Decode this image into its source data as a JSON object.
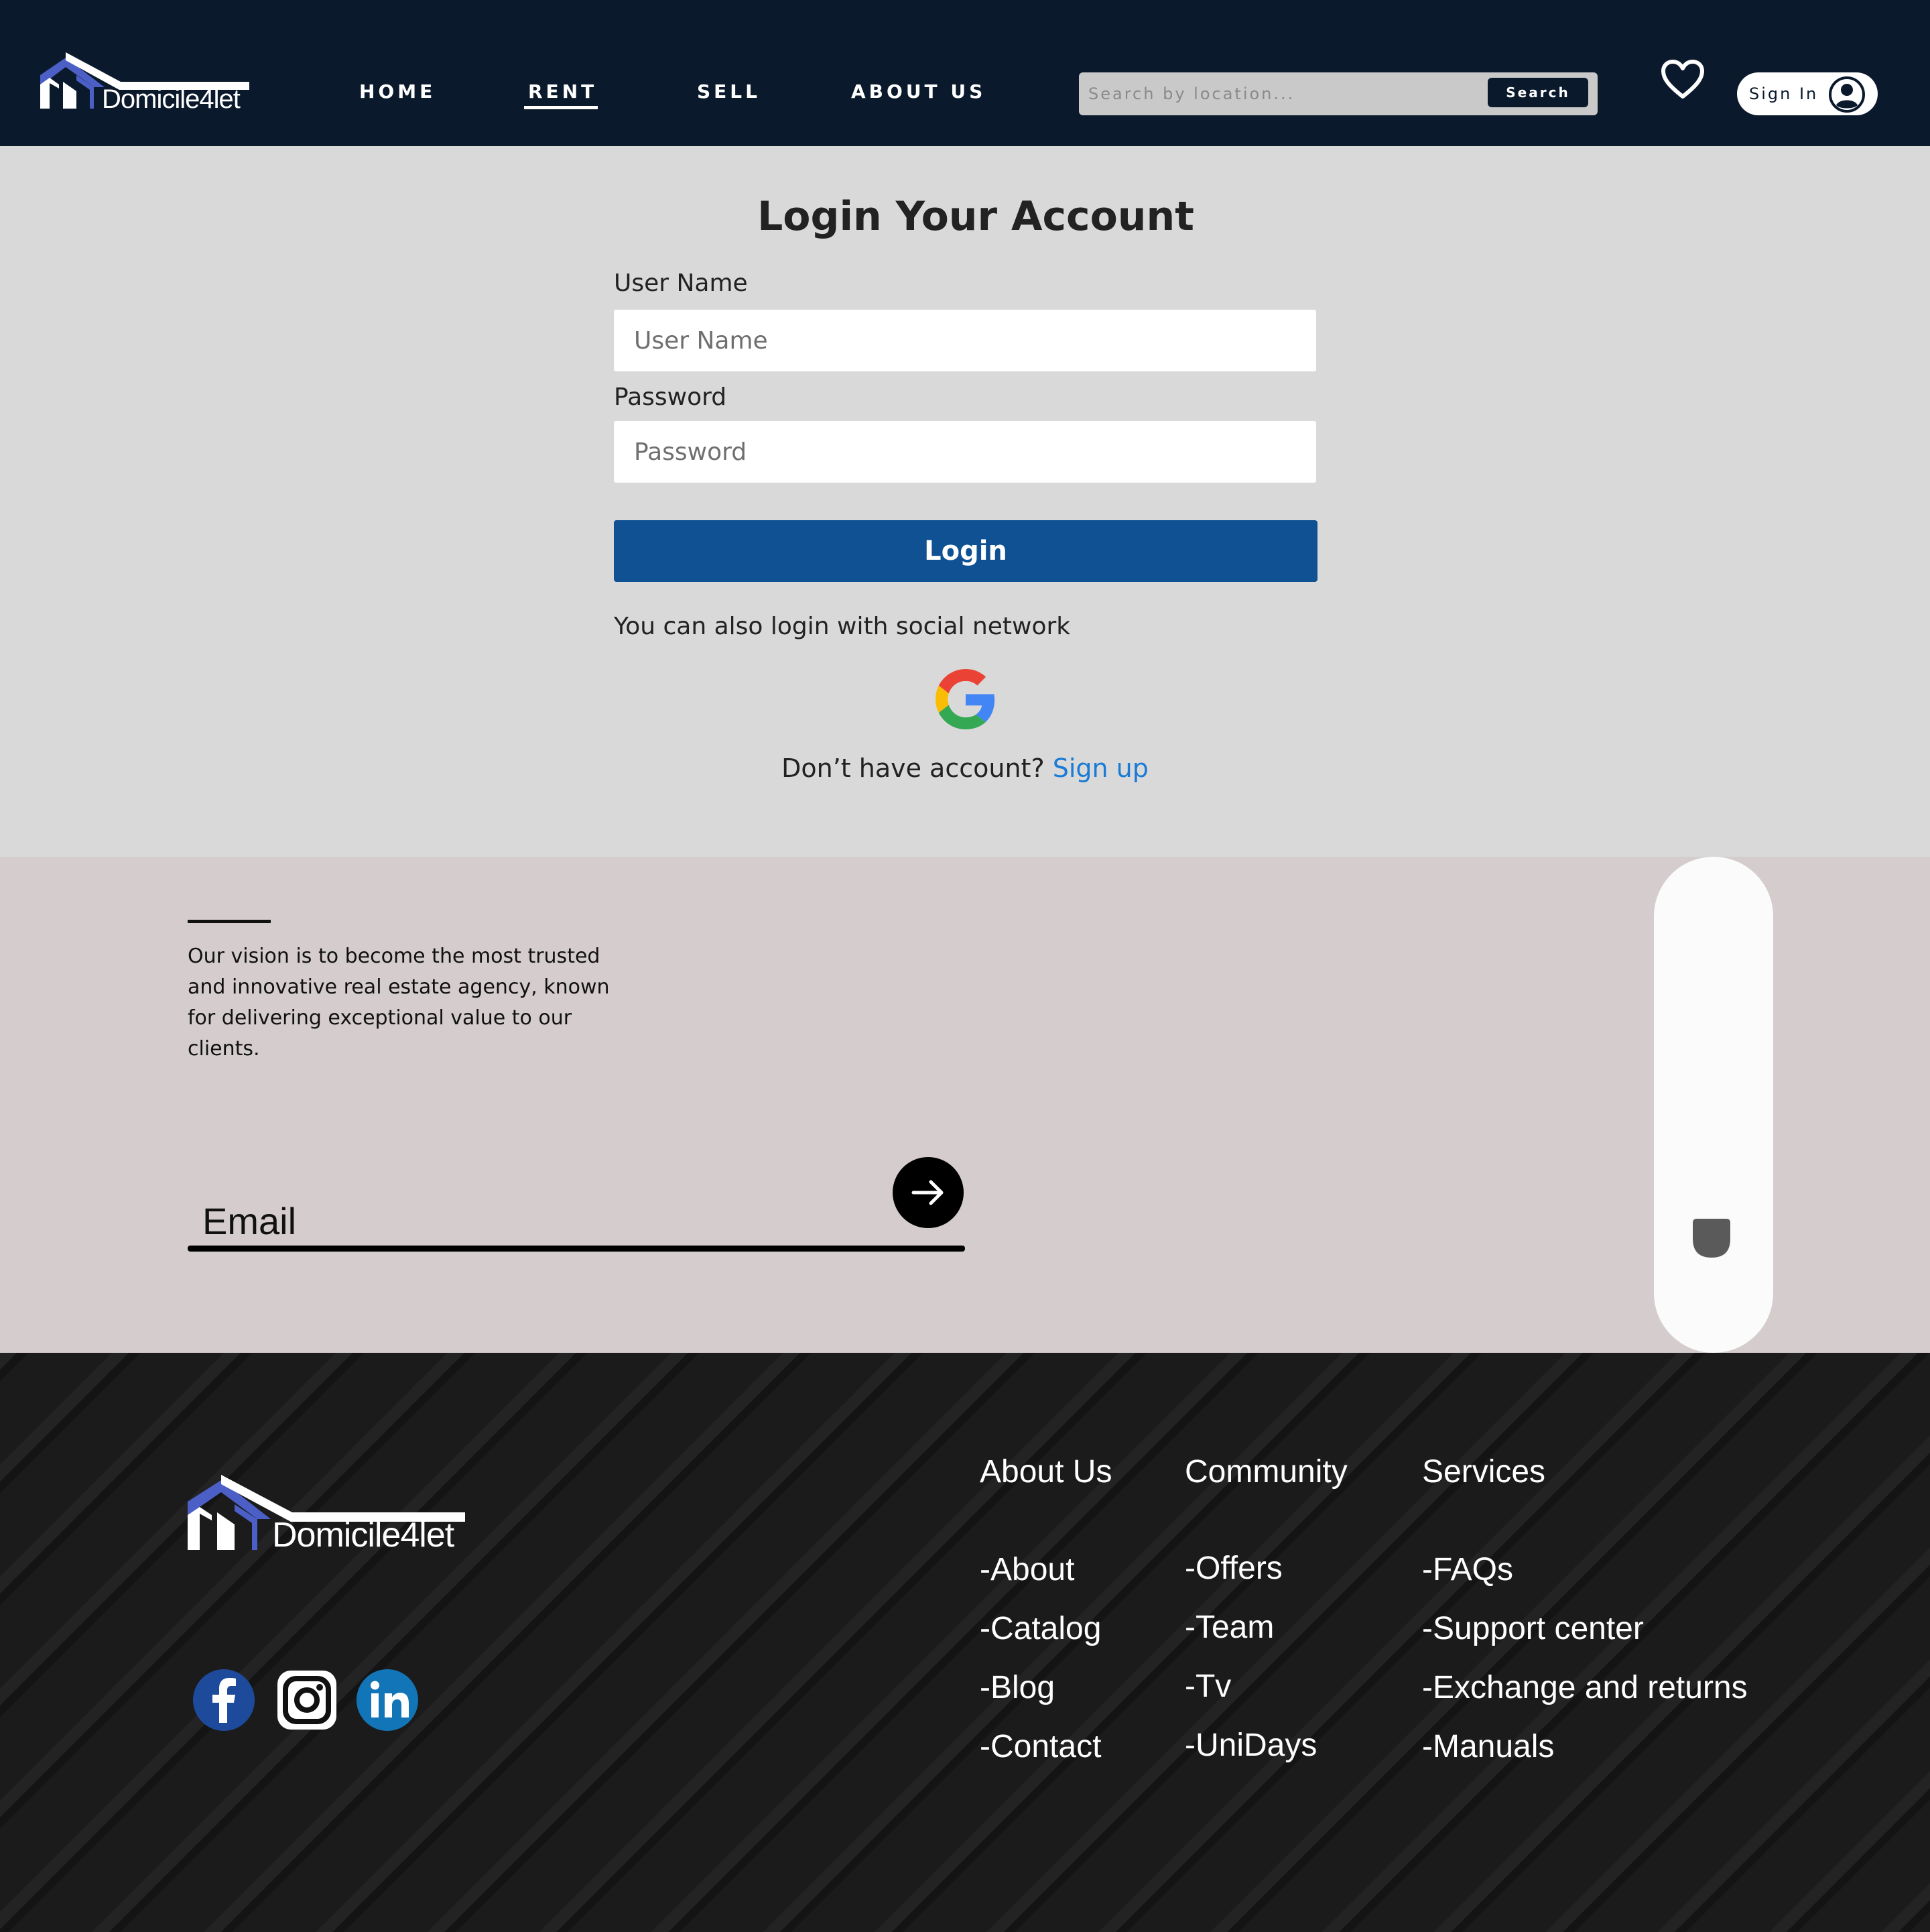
{
  "header": {
    "logo_text": "Domicile4let",
    "nav": [
      {
        "label": "HOME"
      },
      {
        "label": "RENT"
      },
      {
        "label": "SELL"
      },
      {
        "label": "ABOUT US"
      }
    ],
    "active_nav": "RENT",
    "search": {
      "placeholder": "Search by location...",
      "button_label": "Search"
    },
    "wishlist_icon": "heart-icon",
    "signin_label": "Sign In",
    "avatar_icon": "user-circle-icon"
  },
  "login": {
    "title": "Login Your Account",
    "username_label": "User Name",
    "username_placeholder": "User Name",
    "password_label": "Password",
    "password_placeholder": "Password",
    "login_button": "Login",
    "social_text": "You can also login with social network",
    "social_icon": "google-icon",
    "no_account_text": "Don’t have account?",
    "signup_link": "Sign up"
  },
  "newsletter": {
    "vision_text": "Our vision is to become the most trusted and innovative real estate agency, known for delivering exceptional value to our clients.",
    "email_placeholder": "Email",
    "submit_icon": "arrow-right-icon"
  },
  "footer": {
    "logo_text": "Domicile4let",
    "social": [
      "facebook-icon",
      "instagram-icon",
      "linkedin-icon"
    ],
    "columns": [
      {
        "title": "About Us",
        "links": [
          "-About",
          "-Catalog",
          "-Blog",
          "-Contact"
        ]
      },
      {
        "title": "Community",
        "links": [
          "-Offers",
          "-Team",
          "-Tv",
          "-UniDays"
        ]
      },
      {
        "title": "Services",
        "links": [
          "-FAQs",
          "-Support center",
          "-Exchange and returns",
          "-Manuals"
        ]
      }
    ]
  },
  "colors": {
    "header_bg": "#0a192b",
    "login_bg": "#d9d9d9",
    "accent_button": "#0f5193",
    "link": "#1a7bd6",
    "newsletter_bg": "#d5cdcd",
    "footer_bg": "#1b1b1b",
    "logo_accent": "#4b5fc6"
  }
}
